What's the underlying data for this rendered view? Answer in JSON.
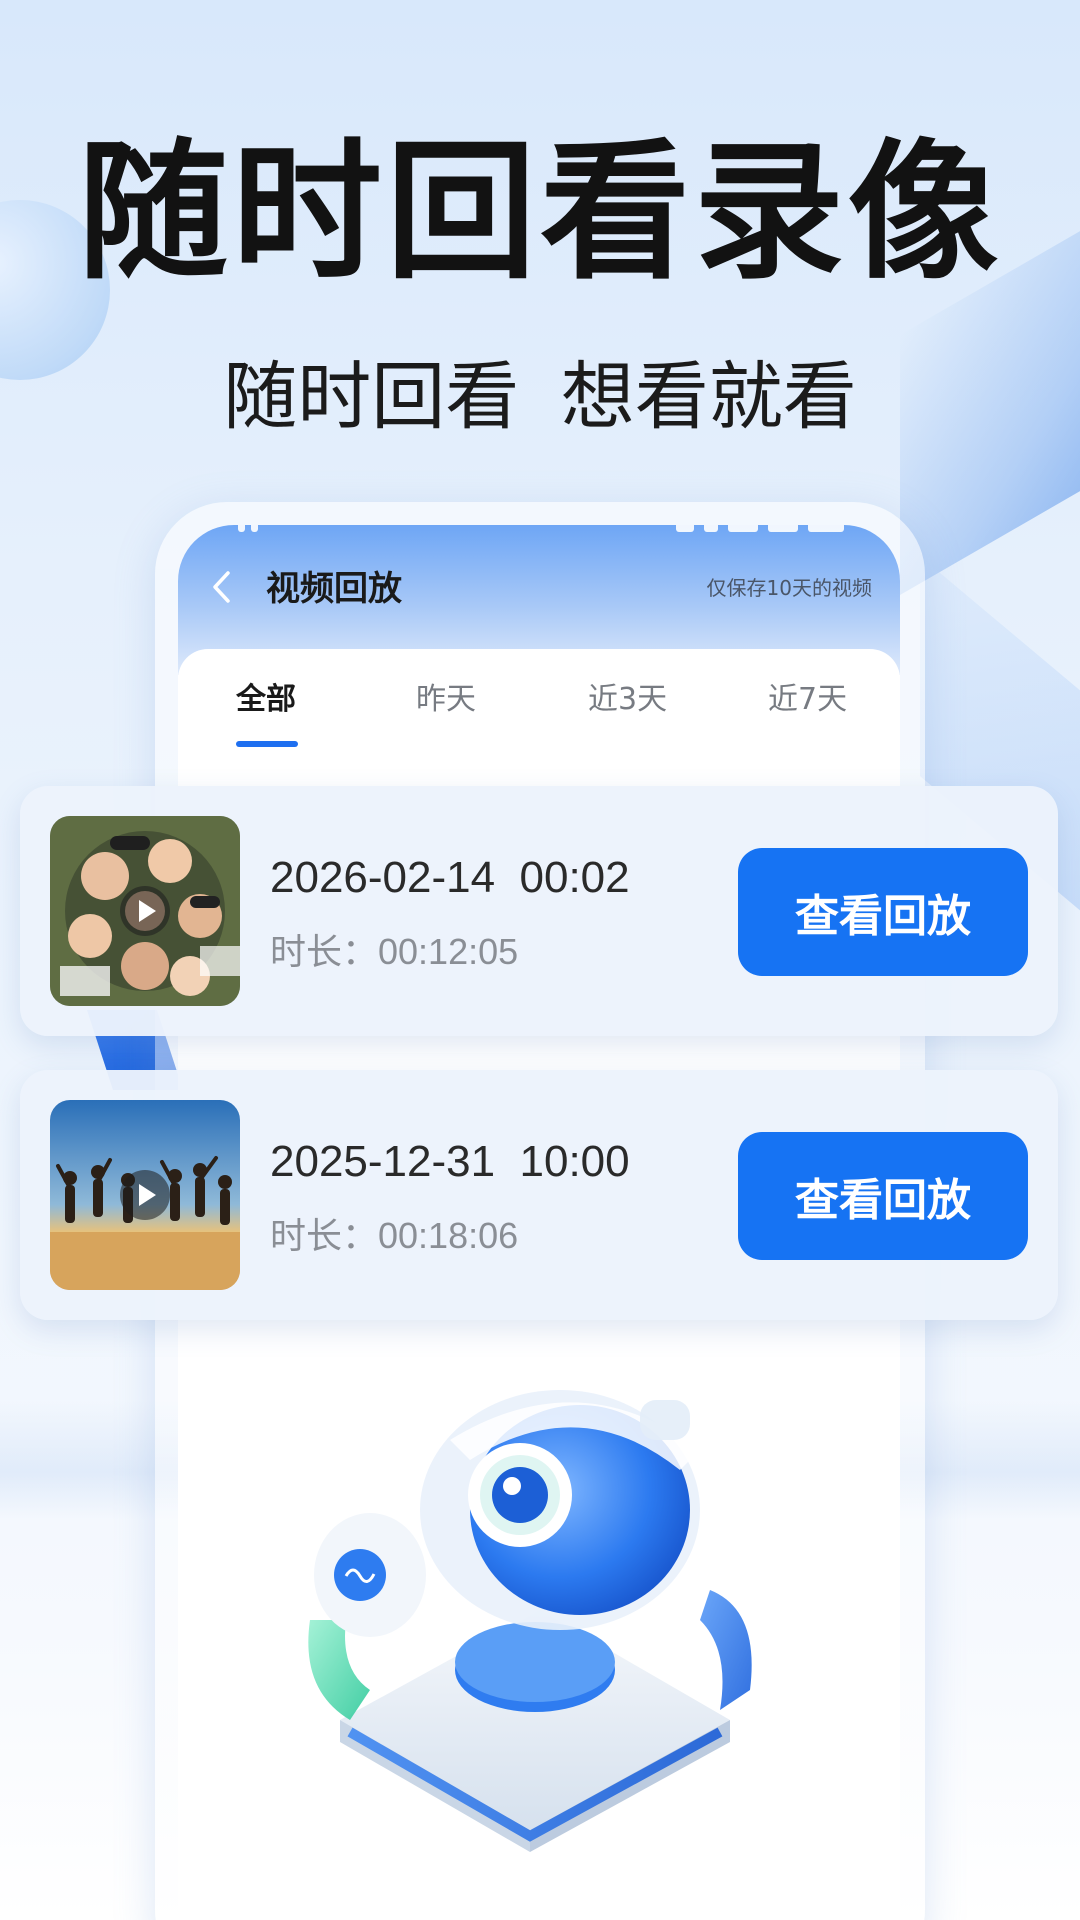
{
  "headline": "随时回看录像",
  "subheadline": "随时回看  想看就看",
  "screen": {
    "title": "视频回放",
    "note": "仅保存10天的视频",
    "tabs": [
      {
        "label": "全部",
        "active": true
      },
      {
        "label": "昨天",
        "active": false
      },
      {
        "label": "近3天",
        "active": false
      },
      {
        "label": "近7天",
        "active": false
      }
    ]
  },
  "recordings": [
    {
      "datetime": "2026-02-14  00:02",
      "duration_label": "时长：",
      "duration": "00:12:05",
      "button": "查看回放"
    },
    {
      "datetime": "2025-12-31  10:00",
      "duration_label": "时长：",
      "duration": "00:18:06",
      "button": "查看回放"
    }
  ],
  "icons": {
    "back": "chevron-left-icon",
    "play": "play-icon"
  },
  "colors": {
    "accent": "#1673f3",
    "tab_underline": "#1e6ff0",
    "headline": "#121212"
  }
}
